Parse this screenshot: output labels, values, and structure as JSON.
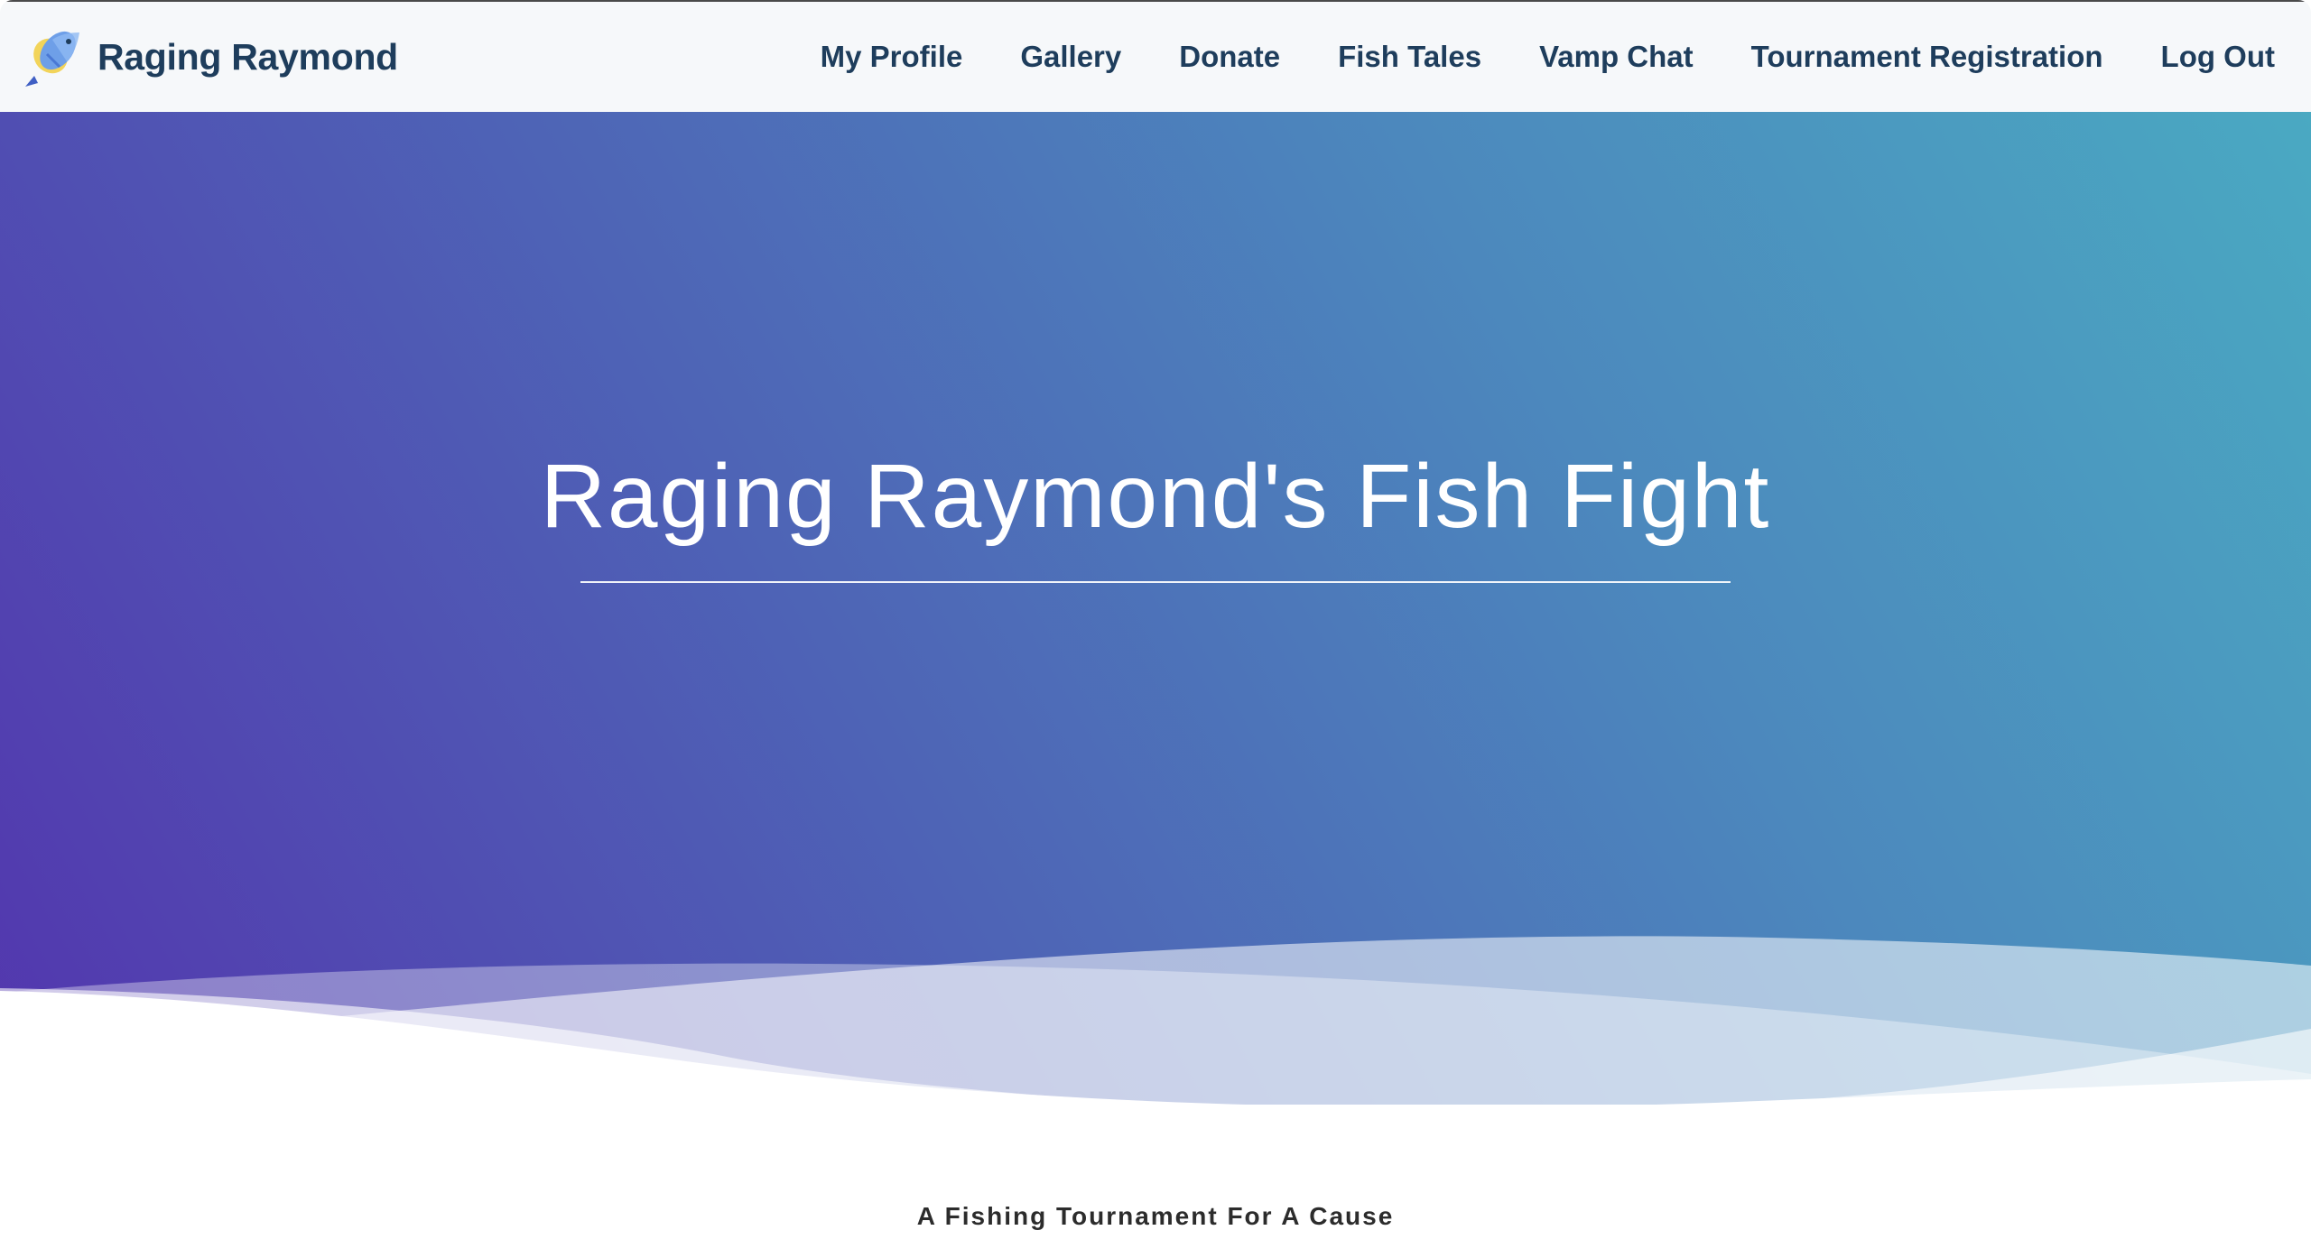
{
  "navbar": {
    "brand": "Raging Raymond",
    "brand_icon": "fish-icon",
    "links": [
      "My Profile",
      "Gallery",
      "Donate",
      "Fish Tales",
      "Vamp Chat",
      "Tournament Registration",
      "Log Out"
    ]
  },
  "hero": {
    "title": "Raging Raymond's Fish Fight",
    "gradient_colors": [
      "#5336ae",
      "#4e64b6",
      "#4c88bd",
      "#4aa9c2"
    ]
  },
  "tagline": "A Fishing Tournament For A Cause",
  "colors": {
    "nav_text": "#1e3d5c",
    "nav_bg": "#f6f8fa"
  }
}
